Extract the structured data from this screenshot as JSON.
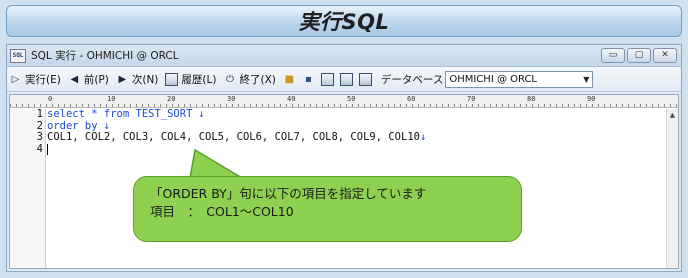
{
  "banner": {
    "title": "実行SQL"
  },
  "window": {
    "icon_label": "SQL",
    "title": "SQL 実行 - OHMICHI @ ORCL",
    "controls": {
      "minimize": "▭",
      "maximize": "▢",
      "close": "✕"
    }
  },
  "toolbar": {
    "execute_label": "実行(E)",
    "prev_label": "前(P)",
    "next_label": "次(N)",
    "history_label": "履歴(L)",
    "exit_label": "終了(X)",
    "database_label": "データベース",
    "database_value": "OHMICHI @ ORCL"
  },
  "ruler": {
    "marks": [
      "0",
      "10",
      "20",
      "30",
      "40",
      "50",
      "60",
      "70",
      "80",
      "90"
    ]
  },
  "editor": {
    "lines": [
      {
        "number": "1",
        "text": "select * from TEST_SORT",
        "eol": "↓"
      },
      {
        "number": "2",
        "text": "order by",
        "eol": "↓"
      },
      {
        "number": "3",
        "text": "COL1, COL2, COL3, COL4, COL5, COL6, COL7, COL8, COL9, COL10",
        "eol": "↓"
      },
      {
        "number": "4",
        "text": "",
        "eol": ""
      }
    ]
  },
  "callout": {
    "line1": "「ORDER BY」句に以下の項目を指定しています",
    "line2": "項目　：　COL1～COL10"
  },
  "colors": {
    "banner_bg": "#bcd6ec",
    "callout_bg": "#8ed151",
    "keyword": "#1c4ad6"
  }
}
